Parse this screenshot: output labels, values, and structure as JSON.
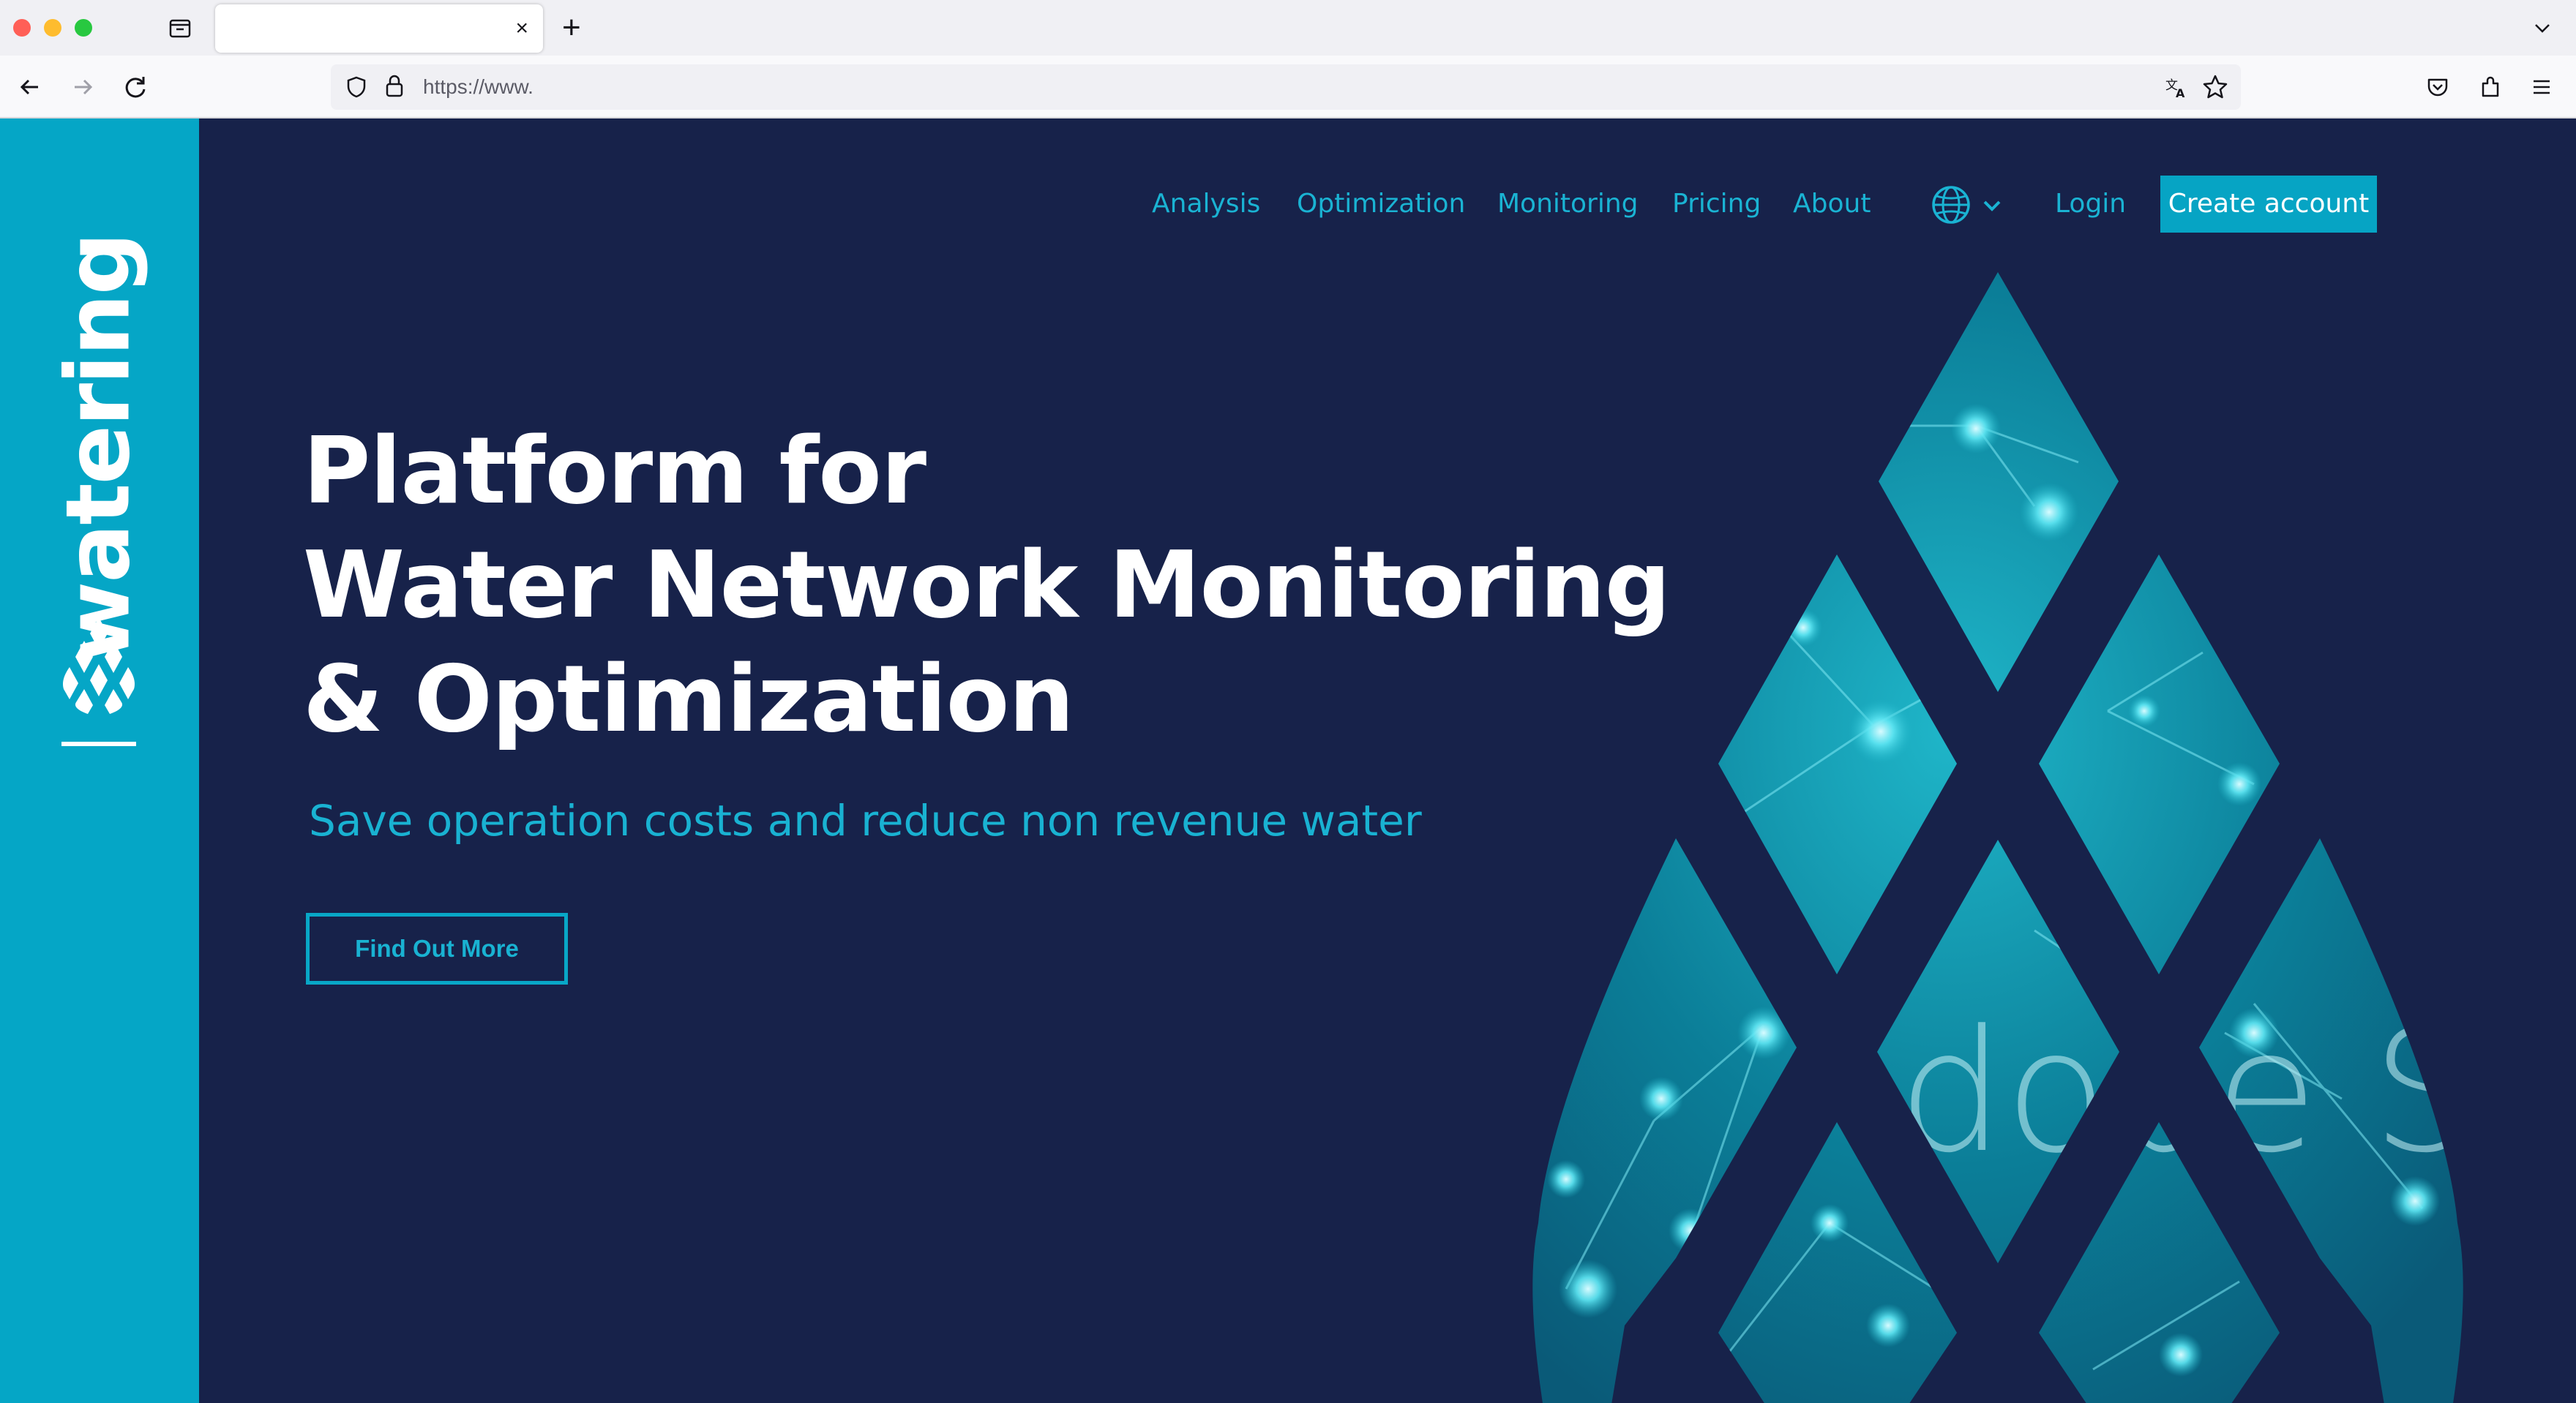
{
  "browser": {
    "tab_close": "×",
    "new_tab": "+",
    "url": "https://www."
  },
  "brand": {
    "logo_text": "watering",
    "accent_color": "#05a6c6",
    "background_color": "#17224a"
  },
  "nav": {
    "links": [
      "Analysis",
      "Optimization",
      "Monitoring",
      "Pricing",
      "About"
    ],
    "language_icon": "globe-icon",
    "login": "Login",
    "create_account": "Create account"
  },
  "hero": {
    "title_lines": [
      "Platform for",
      "Water Network Monitoring",
      "& Optimization"
    ],
    "subtitle": "Save operation costs and reduce non revenue water",
    "cta": "Find Out More"
  },
  "illustration": {
    "watermark_text": "Adobe S"
  }
}
